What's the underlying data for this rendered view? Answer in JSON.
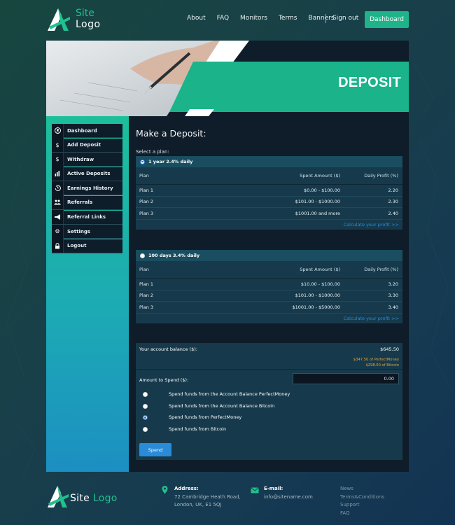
{
  "header": {
    "logo_line1": "Site",
    "logo_line2": "Logo",
    "nav": [
      "About",
      "FAQ",
      "Monitors",
      "Terms",
      "Banners"
    ],
    "signout": "Sign out",
    "dashboard_button": "Dashboard"
  },
  "hero": {
    "title": "DEPOSIT"
  },
  "sidebar": {
    "items": [
      {
        "label": "Dashboard",
        "icon": "user-circle-icon"
      },
      {
        "label": "Add Deposit",
        "icon": "dollar-icon"
      },
      {
        "label": "Withdraw",
        "icon": "dollar-icon"
      },
      {
        "label": "Active Deposits",
        "icon": "bar-chart-icon"
      },
      {
        "label": "Earnings History",
        "icon": "history-icon"
      },
      {
        "label": "Referrals",
        "icon": "users-icon"
      },
      {
        "label": "Referral Links",
        "icon": "megaphone-icon"
      },
      {
        "label": "Settings",
        "icon": "gear-icon"
      },
      {
        "label": "Logout",
        "icon": "lock-icon"
      }
    ]
  },
  "main": {
    "title": "Make a Deposit:",
    "select_plan": "Select a plan:"
  },
  "plans": [
    {
      "name": "1 year 2.4% daily",
      "selected": true,
      "columns": [
        "Plan",
        "Spent Amount ($)",
        "Daily Profit (%)"
      ],
      "rows": [
        [
          "Plan 1",
          "$0.00 - $100.00",
          "2.20"
        ],
        [
          "Plan 2",
          "$101.00 - $1000.00",
          "2.30"
        ],
        [
          "Plan 3",
          "$1001.00 and more",
          "2.40"
        ]
      ],
      "calc_link": "Calculate your profit >>"
    },
    {
      "name": "100 days 3.4% daily",
      "selected": false,
      "columns": [
        "Plan",
        "Spent Amount ($)",
        "Daily Profit (%)"
      ],
      "rows": [
        [
          "Plan 1",
          "$10.00 - $100.00",
          "3.20"
        ],
        [
          "Plan 2",
          "$101.00 - $1000.00",
          "3.30"
        ],
        [
          "Plan 3",
          "$1001.00 - $5000.00",
          "3.40"
        ]
      ],
      "calc_link": "Calculate your profit >>"
    }
  ],
  "balance": {
    "label": "Your account balance ($):",
    "value": "$645.50",
    "sub1": "$347.50 of PerfectMoney",
    "sub2": "$298.00 of Bitcoin",
    "amount_label": "Amount to Spend ($):",
    "amount_value": "0.00",
    "options": [
      {
        "label": "Spend funds from the Account Balance PerfectMoney",
        "selected": false
      },
      {
        "label": "Spend funds from the Account Balance Bitcoin",
        "selected": false
      },
      {
        "label": "Spend funds from PerfectMoney",
        "selected": true
      },
      {
        "label": "Spend funds from Bitcoin",
        "selected": false
      }
    ],
    "spend_button": "Spend"
  },
  "footer": {
    "logo_site": "Site",
    "logo_logo": "Logo",
    "address_head": "Address:",
    "address_l1": "72 Cambridge Heath Road,",
    "address_l2": "London, UK, E1 5QJ",
    "email_head": "E-mail:",
    "email": "info@sitename.com",
    "links": [
      "News",
      "Terms&Conditions",
      "Support",
      "FAQ"
    ]
  },
  "colors": {
    "accent": "#1fb38a",
    "link_blue": "#2a8bd8",
    "panel": "#163a4c",
    "dark": "#0f1c29",
    "balance_sub": "#e0a13a"
  }
}
